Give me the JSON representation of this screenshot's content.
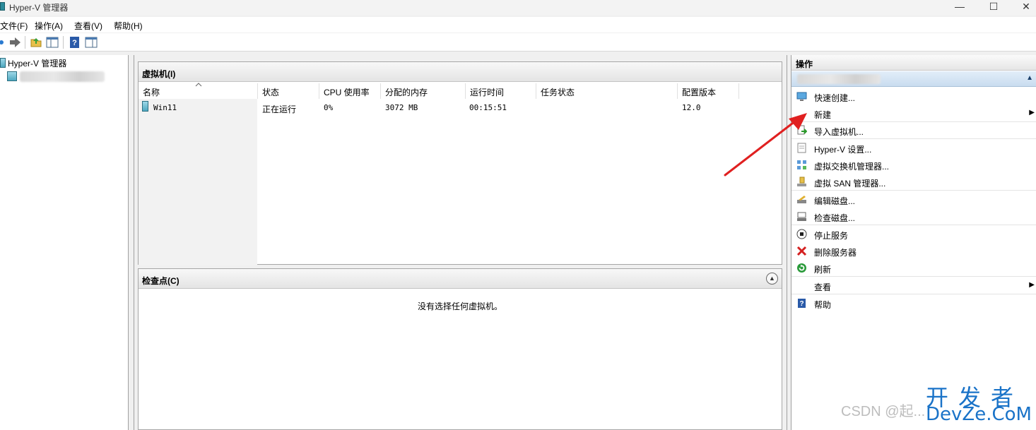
{
  "window": {
    "title": "Hyper-V 管理器",
    "minimize": "—",
    "maximize": "☐",
    "close": "✕"
  },
  "menubar": {
    "items": [
      "文件(F)",
      "操作(A)",
      "查看(V)",
      "帮助(H)"
    ]
  },
  "tree": {
    "root_label": "Hyper-V 管理器"
  },
  "vm_panel": {
    "title": "虚拟机(I)",
    "columns": [
      "名称",
      "状态",
      "CPU 使用率",
      "分配的内存",
      "运行时间",
      "任务状态",
      "配置版本"
    ],
    "rows": [
      {
        "name": "Win11",
        "state": "正在运行",
        "cpu": "0%",
        "memory": "3072 MB",
        "uptime": "00:15:51",
        "task": "",
        "version": "12.0"
      }
    ]
  },
  "checkpoint_panel": {
    "title": "检查点(C)",
    "empty_message": "没有选择任何虚拟机。"
  },
  "actions": {
    "header": "操作",
    "items": [
      {
        "label": "快速创建...",
        "icon": "quick-create-icon",
        "submenu": false
      },
      {
        "label": "新建",
        "icon": "",
        "submenu": true
      },
      {
        "label": "导入虚拟机...",
        "icon": "import-vm-icon",
        "submenu": false
      },
      {
        "label": "Hyper-V 设置...",
        "icon": "settings-icon",
        "submenu": false
      },
      {
        "label": "虚拟交换机管理器...",
        "icon": "switch-manager-icon",
        "submenu": false
      },
      {
        "label": "虚拟 SAN 管理器...",
        "icon": "san-manager-icon",
        "submenu": false
      },
      {
        "label": "编辑磁盘...",
        "icon": "edit-disk-icon",
        "submenu": false
      },
      {
        "label": "检查磁盘...",
        "icon": "inspect-disk-icon",
        "submenu": false
      },
      {
        "label": "停止服务",
        "icon": "stop-service-icon",
        "submenu": false
      },
      {
        "label": "删除服务器",
        "icon": "remove-server-icon",
        "submenu": false
      },
      {
        "label": "刷新",
        "icon": "refresh-icon",
        "submenu": false
      },
      {
        "label": "查看",
        "icon": "",
        "submenu": true
      },
      {
        "label": "帮助",
        "icon": "help-icon",
        "submenu": false
      }
    ]
  },
  "watermark": {
    "csdn": "CSDN @起...",
    "logo_top": "开发者",
    "logo_bottom": "DevZe.CoM"
  },
  "colors": {
    "annotation_arrow": "#e02020",
    "selection_blue": "#c9dcef",
    "watermark_blue": "#1a73c8"
  }
}
